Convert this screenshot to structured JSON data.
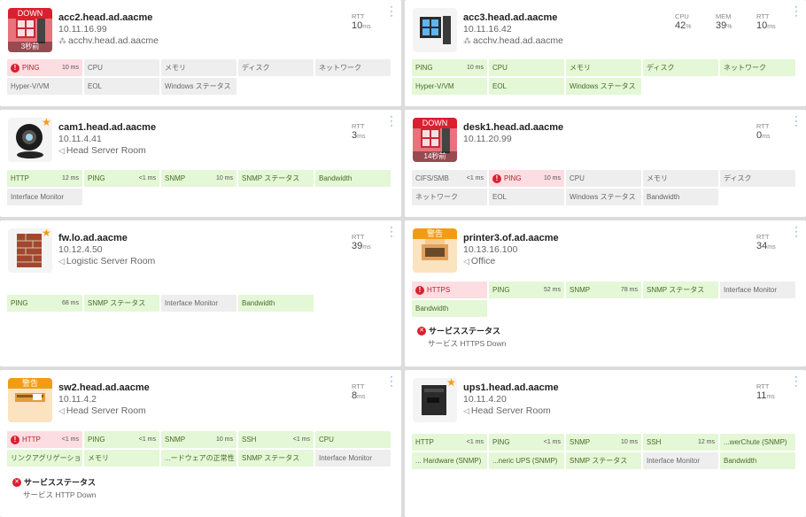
{
  "cards": [
    {
      "status": "DOWN",
      "status_sub": "3秒前",
      "icon": "windows-pc-down",
      "hostname": "acc2.head.ad.aacme",
      "ip": "10.11.16.99",
      "location": "acchv.head.ad.aacme",
      "location_icon": "hierarchy-icon",
      "star": false,
      "metrics": [
        {
          "label": "RTT",
          "value": "10",
          "unit": "ms"
        }
      ],
      "sensors": [
        {
          "name": "PING",
          "value": "10 ms",
          "state": "red",
          "alert": true
        },
        {
          "name": "CPU",
          "value": "",
          "state": "gray"
        },
        {
          "name": "メモリ",
          "value": "",
          "state": "gray"
        },
        {
          "name": "ディスク",
          "value": "",
          "state": "gray"
        },
        {
          "name": "ネットワーク",
          "value": "",
          "state": "gray"
        },
        {
          "name": "Hyper-V/VM",
          "value": "",
          "state": "gray"
        },
        {
          "name": "EOL",
          "value": "",
          "state": "gray"
        },
        {
          "name": "Windows ステータス",
          "value": "",
          "state": "gray"
        }
      ]
    },
    {
      "status": "",
      "status_sub": "",
      "icon": "windows-pc",
      "hostname": "acc3.head.ad.aacme",
      "ip": "10.11.16.42",
      "location": "acchv.head.ad.aacme",
      "location_icon": "hierarchy-icon",
      "star": false,
      "metrics": [
        {
          "label": "CPU",
          "value": "42",
          "unit": "%"
        },
        {
          "label": "MEM",
          "value": "39",
          "unit": "%"
        },
        {
          "label": "RTT",
          "value": "10",
          "unit": "ms"
        }
      ],
      "sensors": [
        {
          "name": "PING",
          "value": "10 ms",
          "state": "green"
        },
        {
          "name": "CPU",
          "value": "",
          "state": "green"
        },
        {
          "name": "メモリ",
          "value": "",
          "state": "green"
        },
        {
          "name": "ディスク",
          "value": "",
          "state": "green"
        },
        {
          "name": "ネットワーク",
          "value": "",
          "state": "green"
        },
        {
          "name": "Hyper-V/VM",
          "value": "",
          "state": "green"
        },
        {
          "name": "EOL",
          "value": "",
          "state": "green"
        },
        {
          "name": "Windows ステータス",
          "value": "",
          "state": "green"
        }
      ]
    },
    {
      "status": "",
      "status_sub": "",
      "icon": "camera",
      "hostname": "cam1.head.ad.aacme",
      "ip": "10.11.4.41",
      "location": "Head Server Room",
      "location_icon": "location-arrow-icon",
      "star": true,
      "metrics": [
        {
          "label": "RTT",
          "value": "3",
          "unit": "ms"
        }
      ],
      "sensors": [
        {
          "name": "HTTP",
          "value": "12 ms",
          "state": "green"
        },
        {
          "name": "PING",
          "value": "<1 ms",
          "state": "green"
        },
        {
          "name": "SNMP",
          "value": "10 ms",
          "state": "green"
        },
        {
          "name": "SNMP ステータス",
          "value": "",
          "state": "green"
        },
        {
          "name": "Bandwidth",
          "value": "",
          "state": "green"
        },
        {
          "name": "Interface Monitor",
          "value": "",
          "state": "gray"
        }
      ]
    },
    {
      "status": "DOWN",
      "status_sub": "14秒前",
      "icon": "windows-pc-down",
      "hostname": "desk1.head.ad.aacme",
      "ip": "10.11.20.99",
      "location": "",
      "location_icon": "",
      "star": false,
      "metrics": [
        {
          "label": "RTT",
          "value": "0",
          "unit": "ms"
        }
      ],
      "sensors": [
        {
          "name": "CIFS/SMB",
          "value": "<1 ms",
          "state": "gray"
        },
        {
          "name": "PING",
          "value": "10 ms",
          "state": "red",
          "alert": true
        },
        {
          "name": "CPU",
          "value": "",
          "state": "gray"
        },
        {
          "name": "メモリ",
          "value": "",
          "state": "gray"
        },
        {
          "name": "ディスク",
          "value": "",
          "state": "gray"
        },
        {
          "name": "ネットワーク",
          "value": "",
          "state": "gray"
        },
        {
          "name": "EOL",
          "value": "",
          "state": "gray"
        },
        {
          "name": "Windows ステータス",
          "value": "",
          "state": "gray"
        },
        {
          "name": "Bandwidth",
          "value": "",
          "state": "gray"
        }
      ]
    },
    {
      "status": "",
      "status_sub": "",
      "icon": "firewall",
      "hostname": "fw.lo.ad.aacme",
      "ip": "10.12.4.50",
      "location": "Logistic Server Room",
      "location_icon": "location-arrow-icon",
      "star": true,
      "metrics": [
        {
          "label": "RTT",
          "value": "39",
          "unit": "ms"
        }
      ],
      "sensors": [
        {
          "name": "PING",
          "value": "68 ms",
          "state": "green"
        },
        {
          "name": "SNMP ステータス",
          "value": "",
          "state": "green"
        },
        {
          "name": "Interface Monitor",
          "value": "",
          "state": "gray"
        },
        {
          "name": "Bandwidth",
          "value": "",
          "state": "green"
        }
      ]
    },
    {
      "status": "警告",
      "status_sub": "",
      "icon": "printer",
      "hostname": "printer3.of.ad.aacme",
      "ip": "10.13.16.100",
      "location": "Office",
      "location_icon": "location-arrow-icon",
      "star": false,
      "metrics": [
        {
          "label": "RTT",
          "value": "34",
          "unit": "ms"
        }
      ],
      "sensors": [
        {
          "name": "HTTPS",
          "value": "",
          "state": "red",
          "alert": true
        },
        {
          "name": "PING",
          "value": "52 ms",
          "state": "green"
        },
        {
          "name": "SNMP",
          "value": "78 ms",
          "state": "green"
        },
        {
          "name": "SNMP ステータス",
          "value": "",
          "state": "green"
        },
        {
          "name": "Interface Monitor",
          "value": "",
          "state": "gray"
        },
        {
          "name": "Bandwidth",
          "value": "",
          "state": "green"
        }
      ],
      "alert": {
        "title": "サービスステータス",
        "detail": "サービス HTTPS Down"
      }
    },
    {
      "status": "警告",
      "status_sub": "",
      "icon": "switch",
      "hostname": "sw2.head.ad.aacme",
      "ip": "10.11.4.2",
      "location": "Head Server Room",
      "location_icon": "location-arrow-icon",
      "star": false,
      "metrics": [
        {
          "label": "RTT",
          "value": "8",
          "unit": "ms"
        }
      ],
      "sensors": [
        {
          "name": "HTTP",
          "value": "<1 ms",
          "state": "red",
          "alert": true
        },
        {
          "name": "PING",
          "value": "<1 ms",
          "state": "green"
        },
        {
          "name": "SNMP",
          "value": "10 ms",
          "state": "green"
        },
        {
          "name": "SSH",
          "value": "<1 ms",
          "state": "green"
        },
        {
          "name": "CPU",
          "value": "",
          "state": "green"
        },
        {
          "name": "リンクアグリゲーション",
          "value": "",
          "state": "green"
        },
        {
          "name": "メモリ",
          "value": "",
          "state": "green"
        },
        {
          "name": "...ードウェアの正常性",
          "value": "",
          "state": "green"
        },
        {
          "name": "SNMP ステータス",
          "value": "",
          "state": "green"
        },
        {
          "name": "Interface Monitor",
          "value": "",
          "state": "gray"
        }
      ],
      "alert": {
        "title": "サービスステータス",
        "detail": "サービス HTTP Down"
      }
    },
    {
      "status": "",
      "status_sub": "",
      "icon": "ups",
      "hostname": "ups1.head.ad.aacme",
      "ip": "10.11.4.20",
      "location": "Head Server Room",
      "location_icon": "location-arrow-icon",
      "star": true,
      "metrics": [
        {
          "label": "RTT",
          "value": "11",
          "unit": "ms"
        }
      ],
      "sensors": [
        {
          "name": "HTTP",
          "value": "<1 ms",
          "state": "green"
        },
        {
          "name": "PING",
          "value": "<1 ms",
          "state": "green"
        },
        {
          "name": "SNMP",
          "value": "10 ms",
          "state": "green"
        },
        {
          "name": "SSH",
          "value": "12 ms",
          "state": "green"
        },
        {
          "name": "...werChute (SNMP)",
          "value": "",
          "state": "green"
        },
        {
          "name": "... Hardware (SNMP)",
          "value": "",
          "state": "green"
        },
        {
          "name": "...neric UPS (SNMP)",
          "value": "",
          "state": "green"
        },
        {
          "name": "SNMP ステータス",
          "value": "",
          "state": "green"
        },
        {
          "name": "Interface Monitor",
          "value": "",
          "state": "gray"
        },
        {
          "name": "Bandwidth",
          "value": "",
          "state": "green"
        }
      ]
    }
  ]
}
